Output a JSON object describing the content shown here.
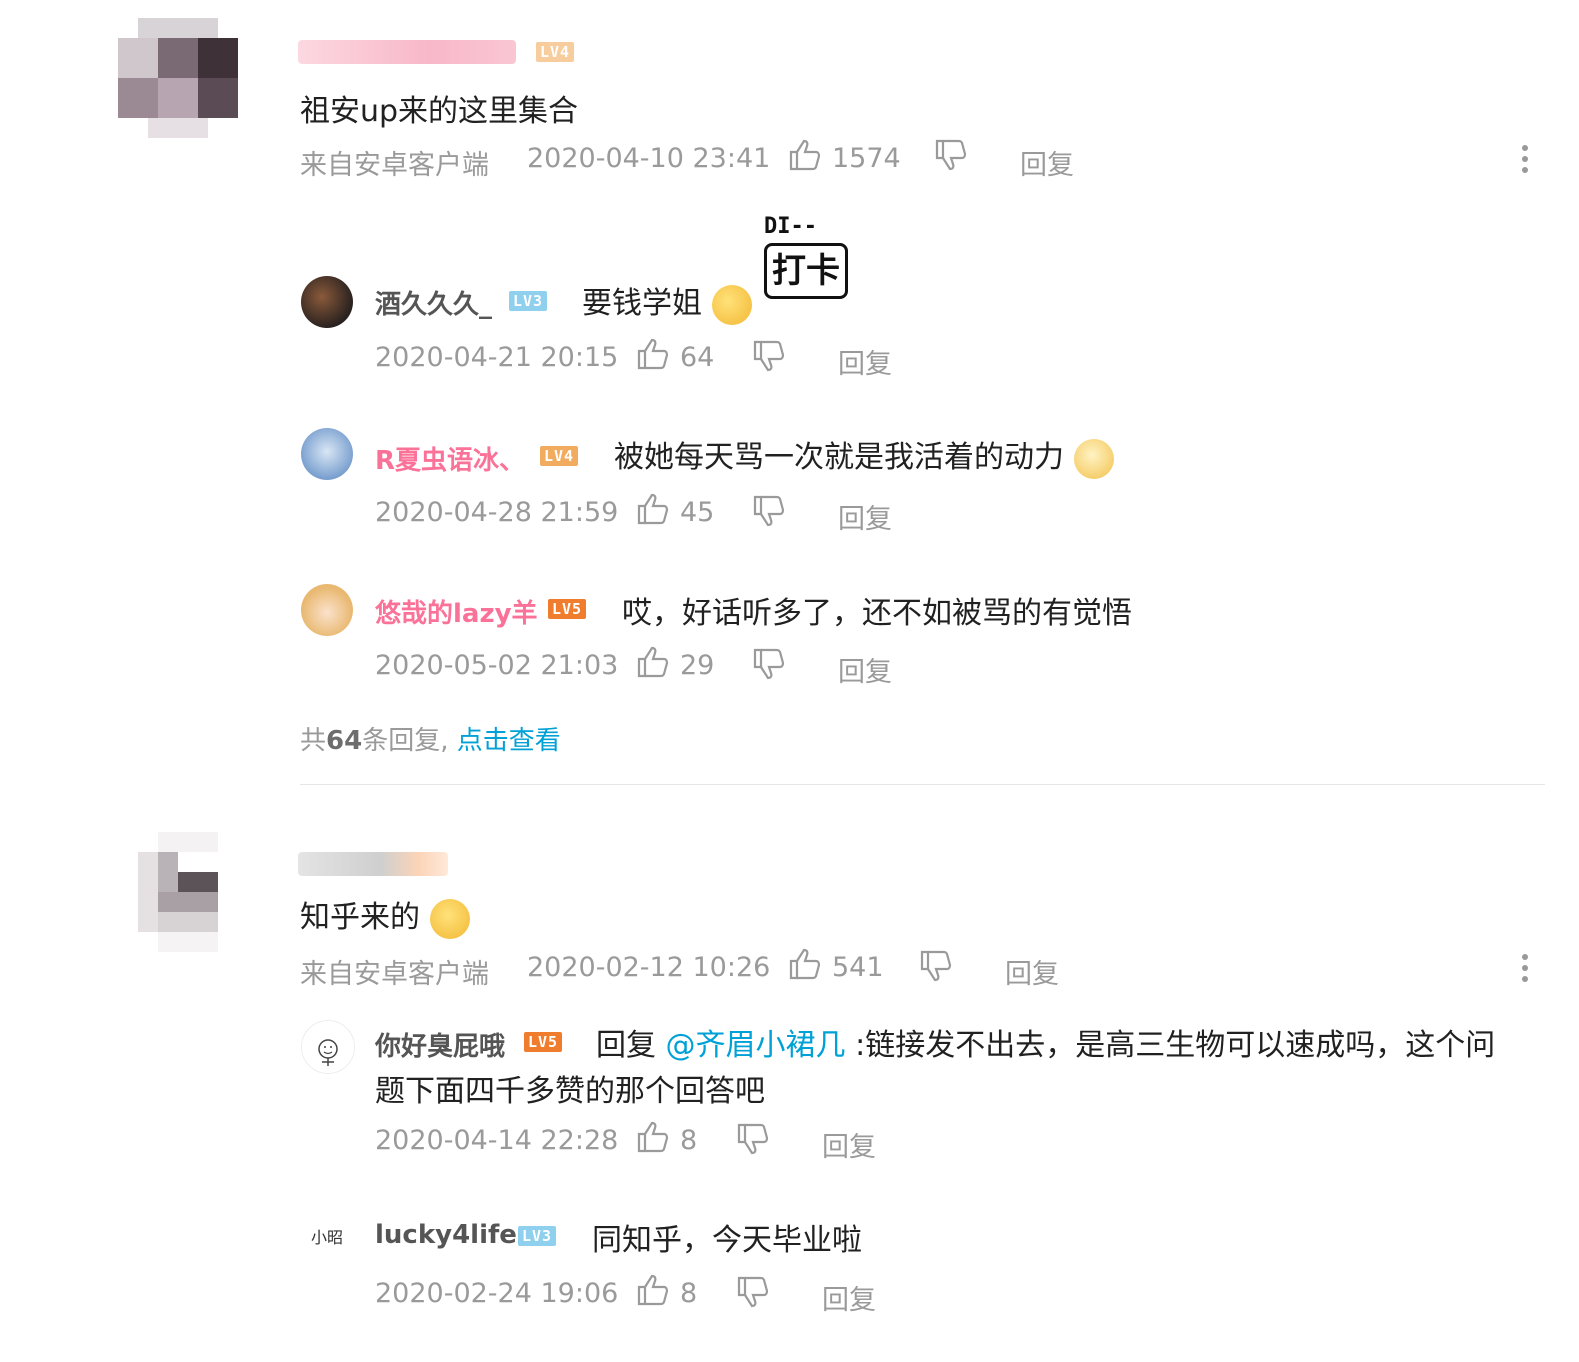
{
  "comments": [
    {
      "content": "祖安up来的这里集合",
      "level": "LV4",
      "source": "来自安卓客户端",
      "time": "2020-04-10 23:41",
      "likes": "1574",
      "reply_label": "回复",
      "replies": [
        {
          "username": "酒久久久_",
          "level": "LV3",
          "text": "要钱学姐",
          "time": "2020-04-21 20:15",
          "likes": "64",
          "reply_label": "回复",
          "sticker_text_1": "DI--",
          "sticker_text_2": "打卡"
        },
        {
          "username": "R夏虫语冰、",
          "level": "LV4",
          "text": "被她每天骂一次就是我活着的动力",
          "time": "2020-04-28 21:59",
          "likes": "45",
          "reply_label": "回复"
        },
        {
          "username": "悠哉的lazy羊",
          "level": "LV5",
          "text": "哎，好话听多了，还不如被骂的有觉悟",
          "time": "2020-05-02 21:03",
          "likes": "29",
          "reply_label": "回复"
        }
      ],
      "more": {
        "prefix": "共",
        "count": "64",
        "suffix": "条回复,",
        "link": "点击查看"
      }
    },
    {
      "content": "知乎来的",
      "source": "来自安卓客户端",
      "time": "2020-02-12 10:26",
      "likes": "541",
      "reply_label": "回复",
      "replies": [
        {
          "username": "你好臭屁哦",
          "level": "LV5",
          "reply_prefix": "回复",
          "mention": "@齐眉小裙几",
          "text_line1": ":链接发不出去，是高三生物可以速成吗，这个问",
          "text_line2": "题下面四千多赞的那个回答吧",
          "time": "2020-04-14 22:28",
          "likes": "8",
          "reply_label": "回复"
        },
        {
          "username": "lucky4life",
          "avatar_text": "小昭",
          "level": "LV3",
          "text": "同知乎，今天毕业啦",
          "time": "2020-02-24 19:06",
          "likes": "8",
          "reply_label": "回复"
        }
      ]
    }
  ],
  "colors": {
    "pink_name": "#fb7299",
    "link": "#00a1d6",
    "meta": "#9a9a9a",
    "lv3": "#8fd0ee",
    "lv4": "#f2ac5f",
    "lv5": "#ef7d2d"
  },
  "icons": {
    "like": "thumb-up-icon",
    "dislike": "thumb-down-icon",
    "more": "more-vertical-icon"
  }
}
